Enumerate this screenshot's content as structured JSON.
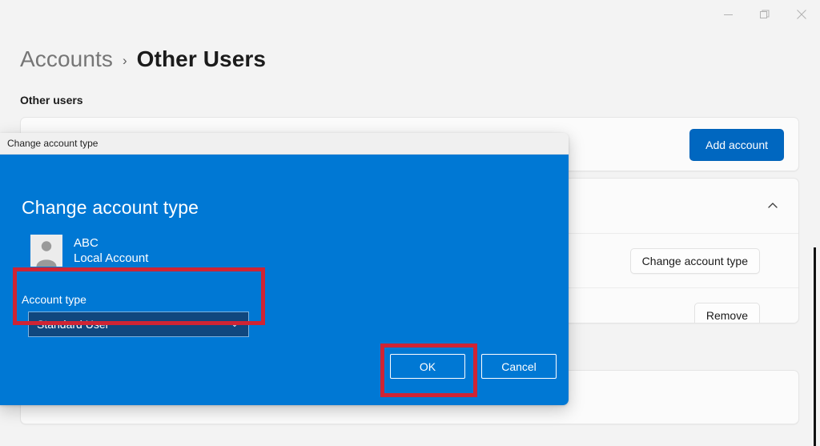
{
  "window": {
    "controls": [
      {
        "name": "minimize",
        "glyph": "minimize-icon"
      },
      {
        "name": "restore",
        "glyph": "restore-icon"
      },
      {
        "name": "close",
        "glyph": "close-icon"
      }
    ]
  },
  "breadcrumb": {
    "parent": "Accounts",
    "separator": "›",
    "current": "Other Users"
  },
  "section": {
    "label": "Other users"
  },
  "cards": {
    "add_account": {
      "button_label": "Add account"
    },
    "user": {
      "expander_icon": "chevron-up-icon",
      "rows": [
        {
          "label": "Change account type"
        },
        {
          "label": "Remove"
        }
      ]
    }
  },
  "dialog": {
    "titlebar_text": "Change account type",
    "heading": "Change account type",
    "account": {
      "avatar_icon": "person-avatar-icon",
      "name": "ABC",
      "subtitle": "Local Account"
    },
    "account_type": {
      "label": "Account type",
      "selected": "Standard User",
      "chevron_icon": "chevron-down-icon"
    },
    "buttons": {
      "ok": "OK",
      "cancel": "Cancel"
    }
  },
  "colors": {
    "dialog_blue": "#0078d4",
    "dropdown_blue": "#10477e",
    "accent_button": "#0067c0",
    "annotation_red": "#cf2434",
    "page_background": "#f3f3f3"
  }
}
